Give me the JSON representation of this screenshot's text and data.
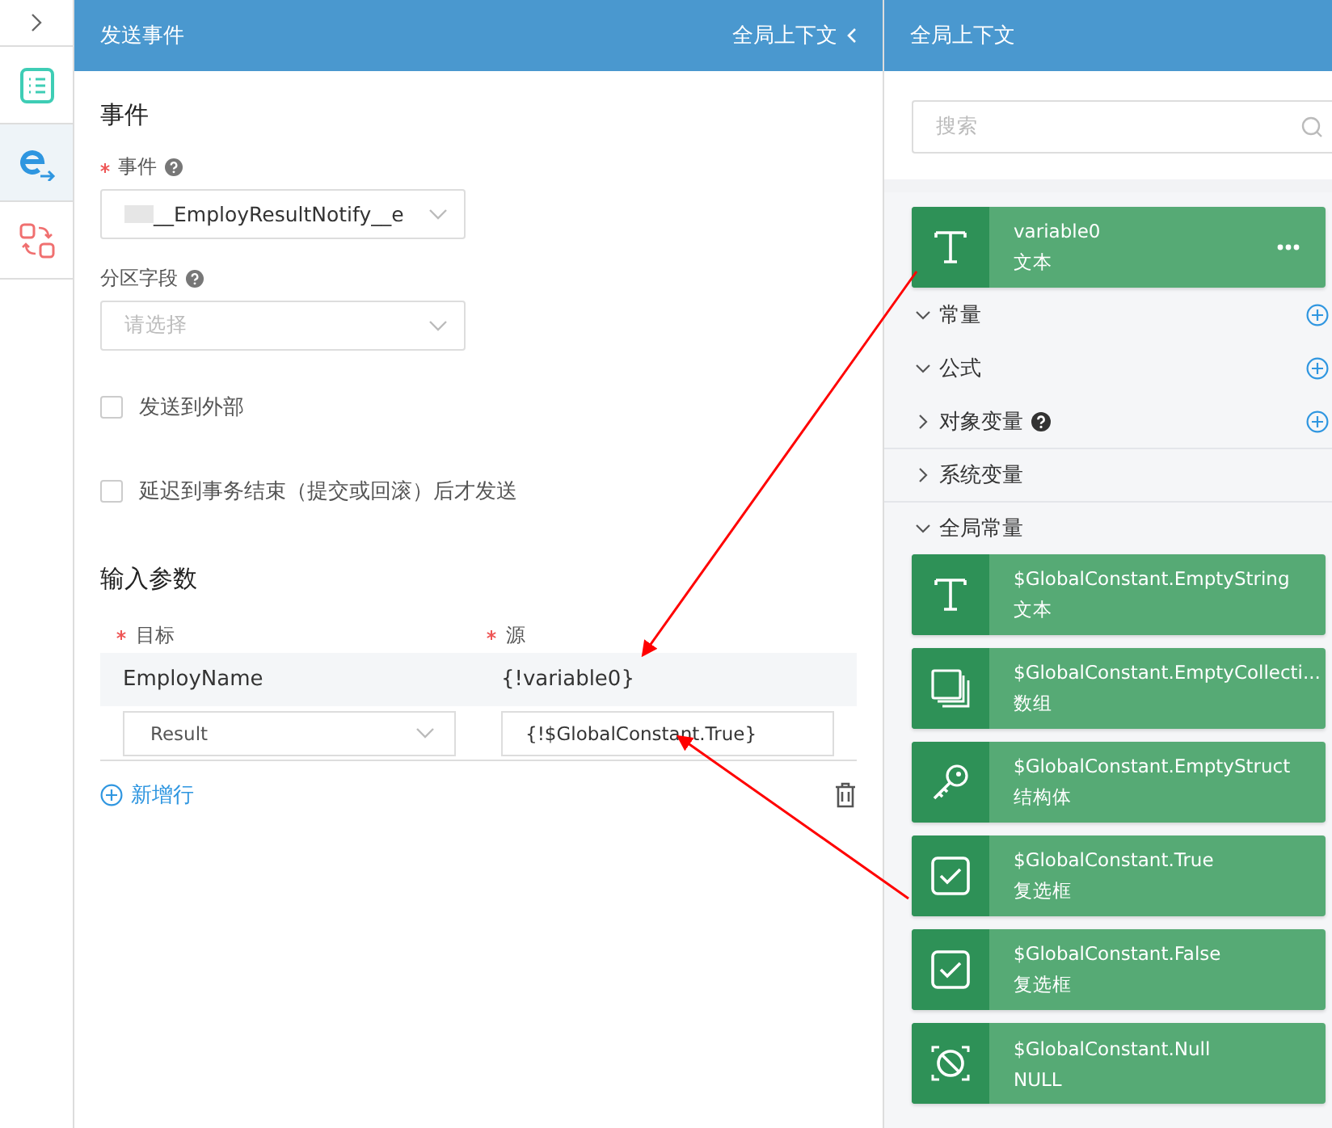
{
  "sidebar": {
    "items": [
      {
        "kind": "list",
        "selected": false
      },
      {
        "kind": "event",
        "selected": true
      },
      {
        "kind": "flow",
        "selected": false
      }
    ]
  },
  "event_panel": {
    "title": "发送事件",
    "context_link": "全局上下文",
    "section_title": "事件",
    "event_field": {
      "label": "事件",
      "required": true,
      "help": true,
      "value": "__EmployResultNotify__e"
    },
    "partition_field": {
      "label": "分区字段",
      "help": true,
      "placeholder": "请选择"
    },
    "checkboxes": [
      {
        "label": "发送到外部",
        "checked": false
      },
      {
        "label": "延迟到事务结束（提交或回滚）后才发送",
        "checked": false
      }
    ],
    "params": {
      "title": "输入参数",
      "columns": [
        {
          "label": "目标",
          "required": true
        },
        {
          "label": "源",
          "required": true
        }
      ],
      "rows": [
        {
          "kind": "text",
          "target": "EmployName",
          "source": "{!variable0}"
        },
        {
          "kind": "edit",
          "target": "Result",
          "source": "{!$GlobalConstant.True}"
        }
      ],
      "add_row": "新增行"
    }
  },
  "context_panel": {
    "title": "全局上下文",
    "search": {
      "placeholder": "搜索"
    },
    "variables": [
      {
        "kind": "text",
        "name": "variable0",
        "type_label": "文本"
      }
    ],
    "sections": [
      {
        "label": "常量",
        "expanded": true,
        "help": false,
        "addable": true
      },
      {
        "label": "公式",
        "expanded": true,
        "help": false,
        "addable": true
      },
      {
        "label": "对象变量",
        "expanded": false,
        "help": true,
        "addable": true
      },
      {
        "label": "系统变量",
        "expanded": false,
        "help": false,
        "addable": false
      },
      {
        "label": "全局常量",
        "expanded": true,
        "help": false,
        "addable": false
      }
    ],
    "constants": [
      {
        "kind": "text",
        "name": "$GlobalConstant.EmptyString",
        "type_label": "文本"
      },
      {
        "kind": "array",
        "name": "$GlobalConstant.EmptyCollecti...",
        "type_label": "数组"
      },
      {
        "kind": "struct",
        "name": "$GlobalConstant.EmptyStruct",
        "type_label": "结构体"
      },
      {
        "kind": "checkbox",
        "name": "$GlobalConstant.True",
        "type_label": "复选框"
      },
      {
        "kind": "checkbox",
        "name": "$GlobalConstant.False",
        "type_label": "复选框"
      },
      {
        "kind": "null",
        "name": "$GlobalConstant.Null",
        "type_label": "NULL"
      }
    ]
  }
}
